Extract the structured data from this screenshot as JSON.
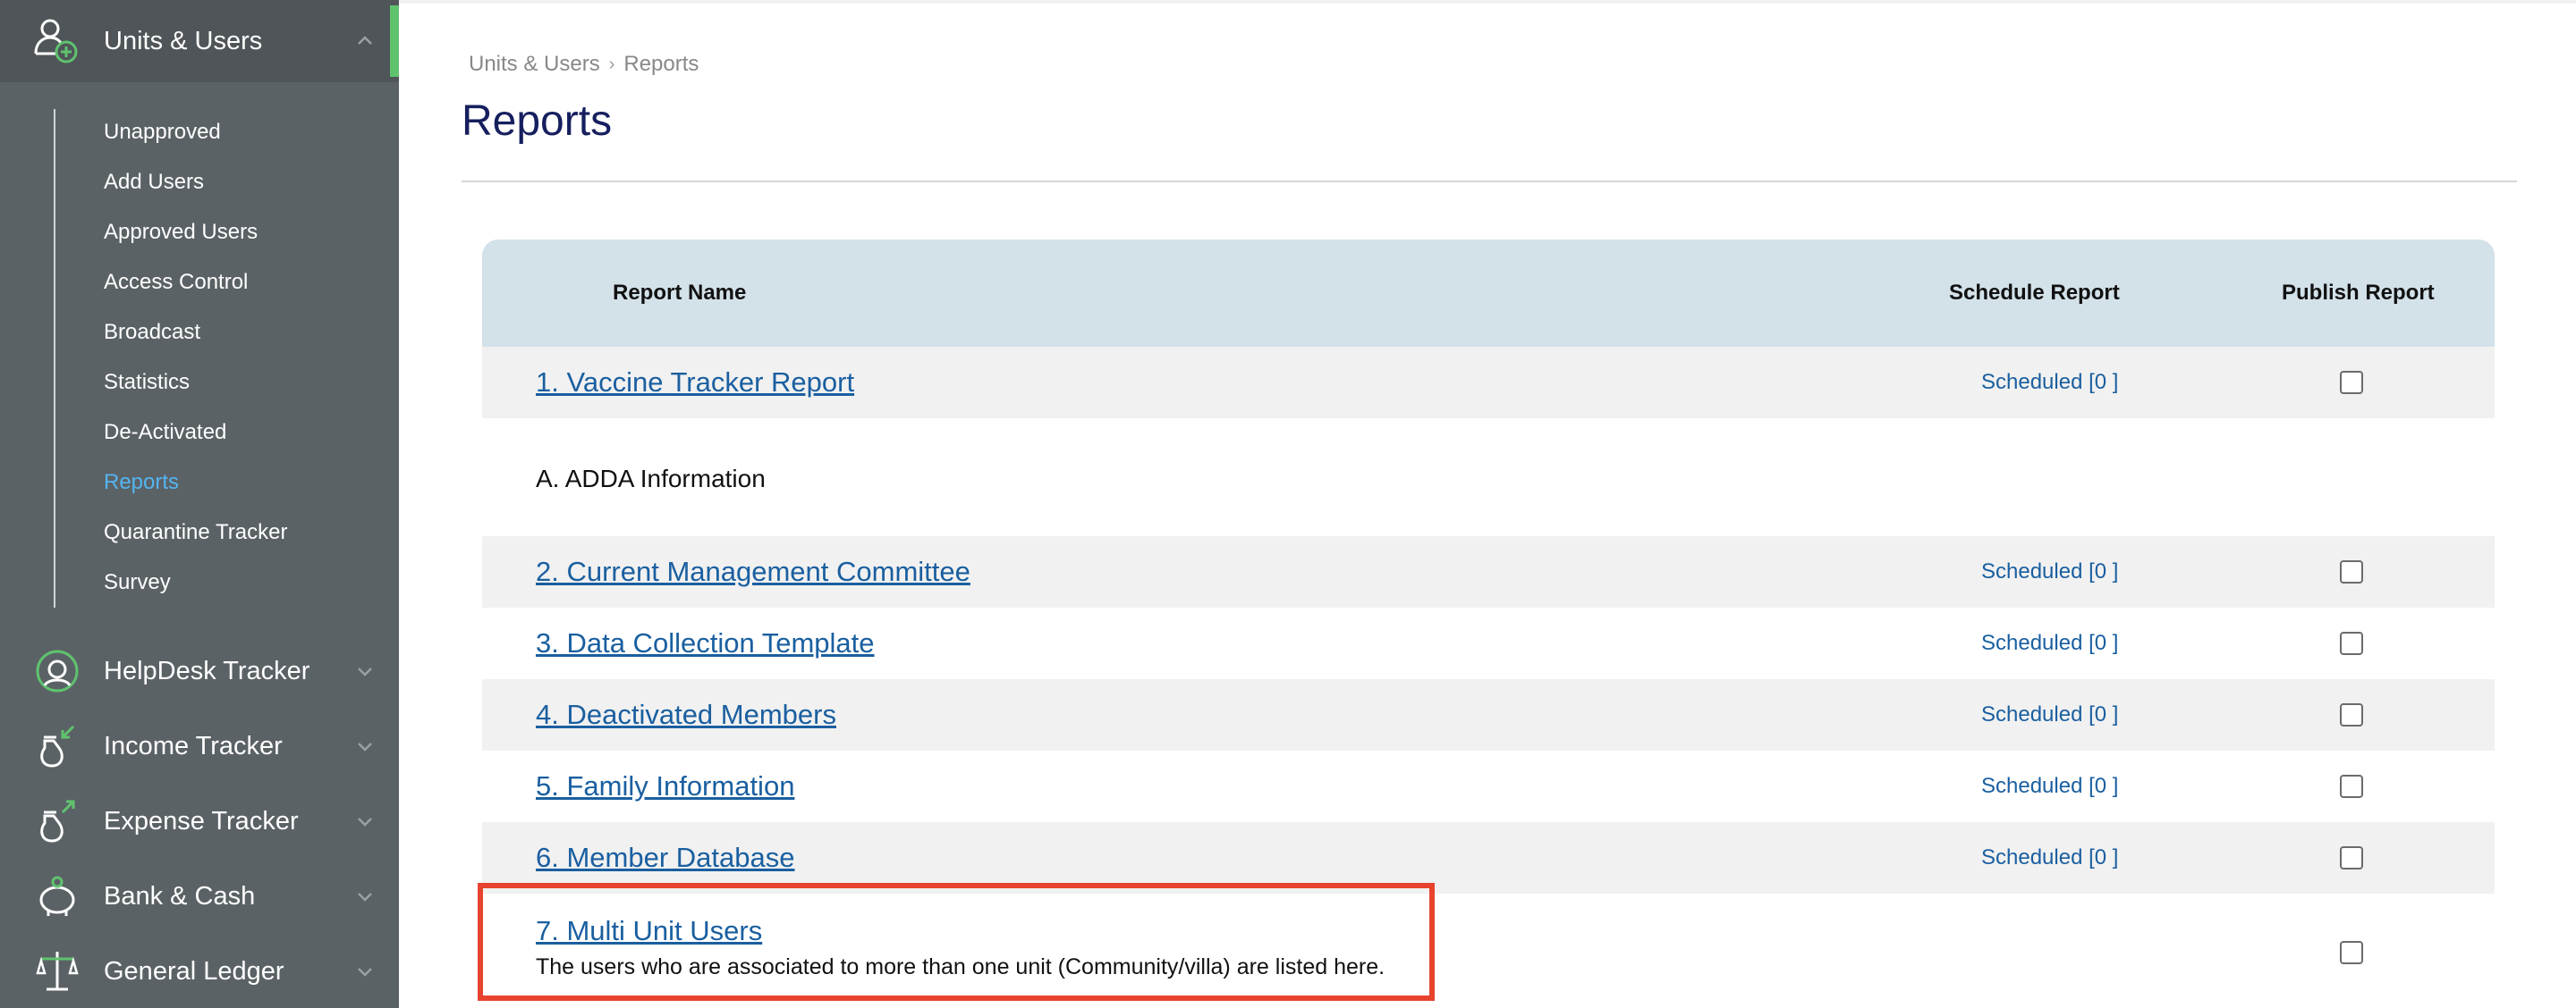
{
  "sidebar": {
    "sections": [
      {
        "label": "Units & Users",
        "icon": "user-add-icon"
      },
      {
        "label": "HelpDesk Tracker",
        "icon": "headset-icon"
      },
      {
        "label": "Income Tracker",
        "icon": "money-bag-in-icon"
      },
      {
        "label": "Expense Tracker",
        "icon": "money-bag-out-icon"
      },
      {
        "label": "Bank & Cash",
        "icon": "piggy-bank-icon"
      },
      {
        "label": "General Ledger",
        "icon": "scales-icon"
      }
    ],
    "submenu": [
      "Unapproved",
      "Add Users",
      "Approved Users",
      "Access Control",
      "Broadcast",
      "Statistics",
      "De-Activated",
      "Reports",
      "Quarantine Tracker",
      "Survey"
    ],
    "active_submenu": "Reports"
  },
  "breadcrumb": {
    "parent": "Units & Users",
    "current": "Reports"
  },
  "page_title": "Reports",
  "table": {
    "headers": {
      "name": "Report Name",
      "schedule": "Schedule Report",
      "publish": "Publish Report"
    },
    "rows": [
      {
        "name": "1. Vaccine Tracker Report",
        "schedule": "Scheduled [0 ]"
      },
      {
        "group": "A. ADDA Information"
      },
      {
        "name": "2. Current Management Committee",
        "schedule": "Scheduled [0 ]"
      },
      {
        "name": "3. Data Collection Template",
        "schedule": "Scheduled [0 ]"
      },
      {
        "name": "4. Deactivated Members",
        "schedule": "Scheduled [0 ]"
      },
      {
        "name": "5. Family Information",
        "schedule": "Scheduled [0 ]"
      },
      {
        "name": "6. Member Database",
        "schedule": "Scheduled [0 ]"
      },
      {
        "name": "7. Multi Unit Users",
        "description": "The users who are associated to more than one unit (Community/villa) are listed here."
      }
    ]
  },
  "colors": {
    "sidebar": "#5b6266",
    "accent_green": "#5fc36e",
    "link": "#1a5fa0",
    "title": "#161f5e",
    "highlight": "#e8432e"
  }
}
